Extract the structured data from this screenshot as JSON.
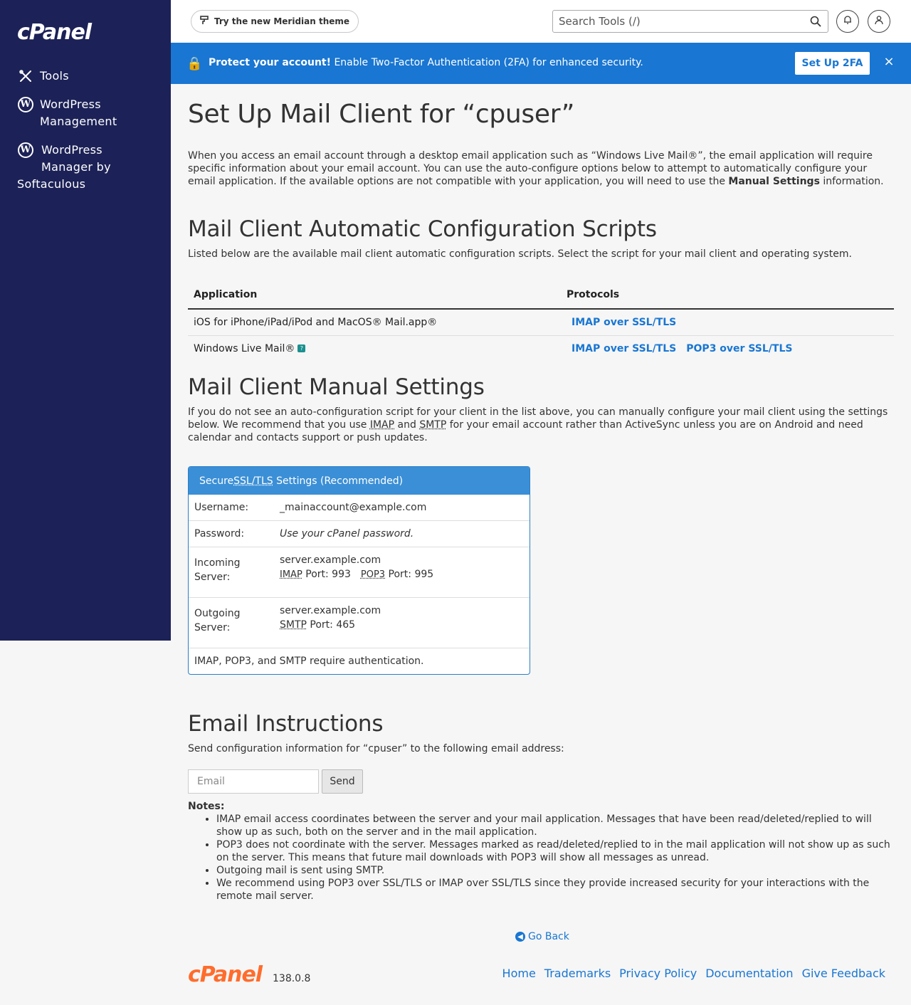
{
  "sidebar": {
    "logo": "cPanel",
    "items": [
      {
        "label": "Tools",
        "icon": "tools-icon"
      },
      {
        "label_line1": "WordPress",
        "label_line2": "Management",
        "icon": "wordpress-icon"
      },
      {
        "label_line1": "WordPress",
        "label_line2": "Manager by",
        "label_line3": "Softaculous",
        "icon": "wordpress-icon"
      }
    ]
  },
  "topbar": {
    "theme_button": "Try the new Meridian theme",
    "search_placeholder": "Search Tools (/)"
  },
  "banner": {
    "strong": "Protect your account!",
    "text": " Enable Two-Factor Authentication (2FA) for enhanced security.",
    "button": "Set Up 2FA",
    "close": "×"
  },
  "page": {
    "title": "Set Up Mail Client for “cpuser”",
    "intro_a": "When you access an email account through a desktop email application such as “Windows Live Mail®”, the email application will require specific information about your email account. You can use the auto-configure options below to attempt to automatically configure your email application. If the available options are not compatible with your application, you will need to use the ",
    "intro_bold": "Manual Settings",
    "intro_b": " information."
  },
  "auto": {
    "heading": "Mail Client Automatic Configuration Scripts",
    "desc": "Listed below are the available mail client automatic configuration scripts. Select the script for your mail client and operating system.",
    "col_app": "Application",
    "col_protocols": "Protocols",
    "rows": [
      {
        "app": "iOS for iPhone/iPad/iPod and MacOS® Mail.app®",
        "p1": "IMAP over SSL/TLS",
        "p2": ""
      },
      {
        "app": "Windows Live Mail®",
        "p1": "IMAP over SSL/TLS",
        "p2": "POP3 over SSL/TLS"
      }
    ]
  },
  "manual": {
    "heading": "Mail Client Manual Settings",
    "desc_a": "If you do not see an auto-configuration script for your client in the list above, you can manually configure your mail client using the settings below. We recommend that you use ",
    "imap": "IMAP",
    "and": " and ",
    "smtp": "SMTP",
    "desc_b": " for your email account rather than ActiveSync unless you are on Android and need calendar and contacts support or push updates.",
    "panel": {
      "head_a": "Secure ",
      "head_abbr": "SSL/TLS",
      "head_b": " Settings (Recommended)",
      "username_label": "Username:",
      "username": "_mainaccount@example.com",
      "password_label": "Password:",
      "password": "Use your cPanel password.",
      "incoming_label_1": "Incoming",
      "incoming_label_2": "Server:",
      "incoming_server": "server.example.com",
      "imap": "IMAP",
      "imap_port": " Port: 993",
      "pop3": "POP3",
      "pop3_port": " Port: 995",
      "outgoing_label_1": "Outgoing",
      "outgoing_label_2": "Server:",
      "outgoing_server": "server.example.com",
      "smtp": "SMTP",
      "smtp_port": " Port: 465",
      "auth_note": "IMAP, POP3, and SMTP require authentication."
    }
  },
  "email": {
    "heading": "Email Instructions",
    "desc": "Send configuration information for “cpuser” to the following email address:",
    "placeholder": "Email",
    "send": "Send",
    "notes_label": "Notes:",
    "notes": [
      "IMAP email access coordinates between the server and your mail application. Messages that have been read/deleted/replied to will show up as such, both on the server and in the mail application.",
      "POP3 does not coordinate with the server. Messages marked as read/deleted/replied to in the mail application will not show up as such on the server. This means that future mail downloads with POP3 will show all messages as unread.",
      "Outgoing mail is sent using SMTP.",
      "We recommend using POP3 over SSL/TLS or IMAP over SSL/TLS since they provide increased security for your interactions with the remote mail server."
    ]
  },
  "footer": {
    "go_back": "Go Back",
    "logo": "cPanel",
    "version": "138.0.8",
    "links": [
      "Home",
      "Trademarks",
      "Privacy Policy",
      "Documentation",
      "Give Feedback"
    ]
  },
  "colors": {
    "sidebar": "#1c2257",
    "banner": "#1976d2",
    "link": "#1976d2",
    "brand_orange": "#ff6c2c"
  }
}
